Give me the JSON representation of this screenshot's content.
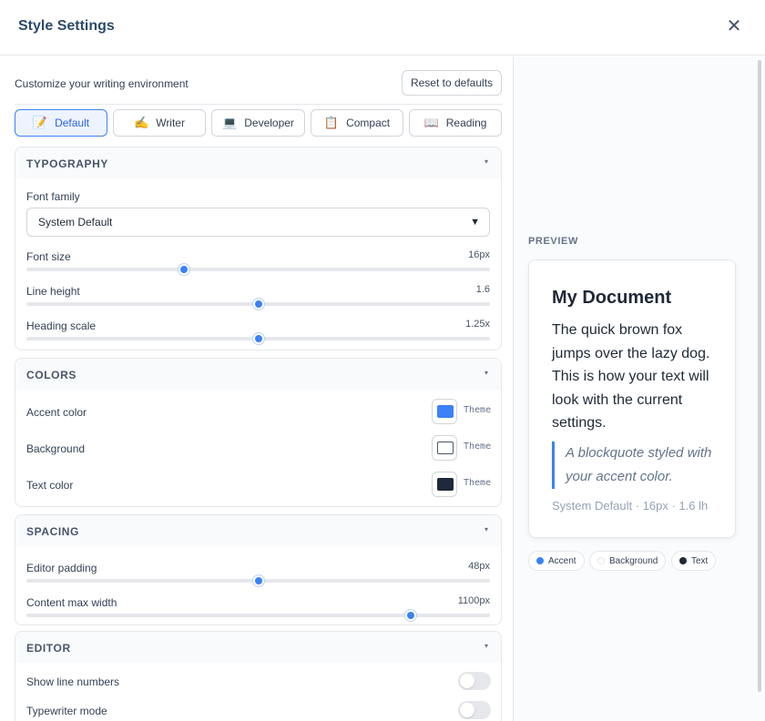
{
  "header": {
    "title": "Style Settings",
    "close_glyph": "✕"
  },
  "intro": {
    "subtitle": "Customize your writing environment",
    "reset_label": "Reset to defaults"
  },
  "presets": [
    {
      "label": "Default",
      "icon": "📝",
      "active": true
    },
    {
      "label": "Writer",
      "icon": "✍️",
      "active": false
    },
    {
      "label": "Developer",
      "icon": "💻",
      "active": false
    },
    {
      "label": "Compact",
      "icon": "📋",
      "active": false
    },
    {
      "label": "Reading",
      "icon": "📖",
      "active": false
    }
  ],
  "typography": {
    "title": "TYPOGRAPHY",
    "font_family_label": "Font family",
    "font_family_value": "System Default",
    "font_size": {
      "label": "Font size",
      "value": "16px",
      "level": 0.34
    },
    "line_height": {
      "label": "Line height",
      "value": "1.6",
      "level": 0.5
    },
    "heading_scale": {
      "label": "Heading scale",
      "value": "1.25x",
      "level": 0.5
    }
  },
  "colors": {
    "title": "COLORS",
    "accent": {
      "label": "Accent color",
      "tag": "Theme",
      "color": "#3b82f6"
    },
    "background": {
      "label": "Background",
      "tag": "Theme",
      "color": "#ffffff"
    },
    "text": {
      "label": "Text color",
      "tag": "Theme",
      "color": "#1e293b"
    }
  },
  "spacing": {
    "title": "SPACING",
    "editor_padding": {
      "label": "Editor padding",
      "value": "48px",
      "level": 0.5
    },
    "content_max_width": {
      "label": "Content max width",
      "value": "1100px",
      "level": 0.83
    }
  },
  "editor": {
    "title": "EDITOR",
    "show_line_numbers": {
      "label": "Show line numbers",
      "on": false
    },
    "typewriter_mode": {
      "label": "Typewriter mode",
      "on": false
    }
  },
  "preview": {
    "label": "PREVIEW",
    "doc_title": "My Document",
    "doc_body": "The quick brown fox jumps over the lazy dog. This is how your text will look with the current settings.",
    "quote": "A blockquote styled with your accent color.",
    "meta": "System Default · 16px · 1.6 lh",
    "legend": [
      {
        "label": "Accent",
        "color": "#3b82f6"
      },
      {
        "label": "Background",
        "color": "#ffffff"
      },
      {
        "label": "Text",
        "color": "#1e293b"
      }
    ]
  },
  "colors_ui": {
    "accent": "#3b82f6",
    "title_color": "#2d4a6b"
  }
}
